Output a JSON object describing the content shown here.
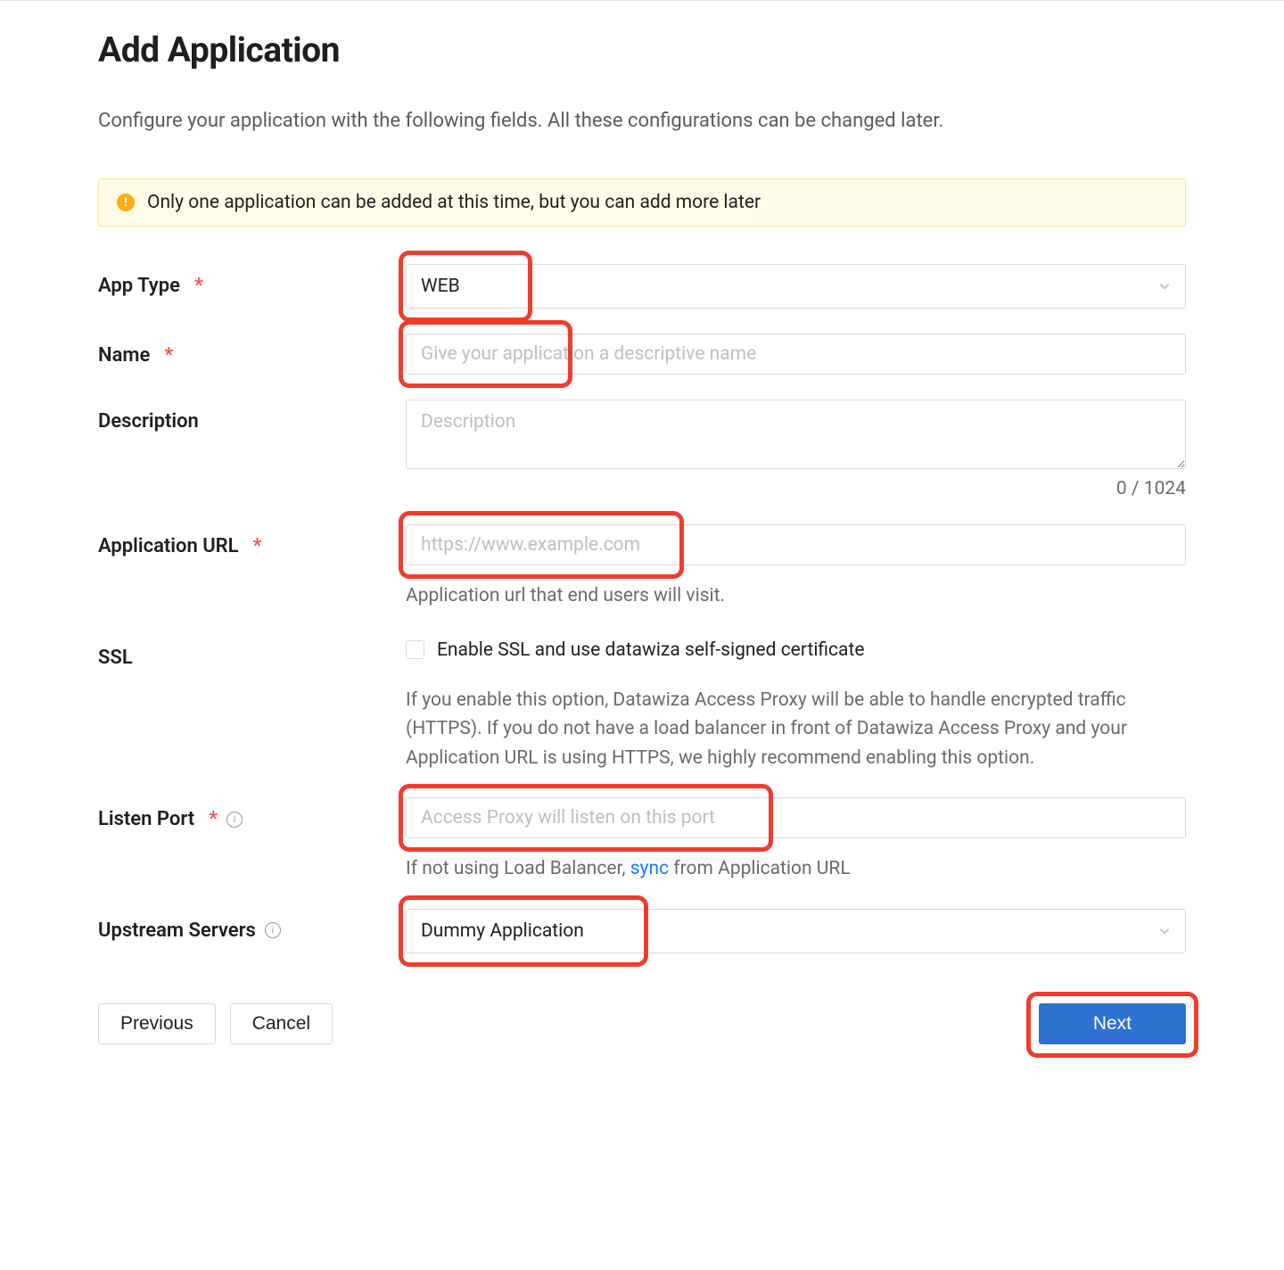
{
  "page": {
    "title": "Add Application",
    "intro": "Configure your application with the following fields. All these configurations can be changed later."
  },
  "alert": {
    "text": "Only one application can be added at this time, but you can add more later"
  },
  "fields": {
    "app_type": {
      "label": "App Type",
      "value": "WEB"
    },
    "name": {
      "label": "Name",
      "placeholder": "Give your application a descriptive name"
    },
    "description": {
      "label": "Description",
      "placeholder": "Description",
      "counter": "0 / 1024"
    },
    "application_url": {
      "label": "Application URL",
      "placeholder": "https://www.example.com",
      "help": "Application url that end users will visit."
    },
    "ssl": {
      "label": "SSL",
      "checkbox_label": "Enable SSL and use datawiza self-signed certificate",
      "help": "If you enable this option, Datawiza Access Proxy will be able to handle encrypted traffic (HTTPS). If you do not have a load balancer in front of Datawiza Access Proxy and your Application URL is using HTTPS, we highly recommend enabling this option."
    },
    "listen_port": {
      "label": "Listen Port",
      "placeholder": "Access Proxy will listen on this port",
      "help_prefix": "If not using Load Balancer, ",
      "help_link": "sync",
      "help_suffix": " from Application URL"
    },
    "upstream": {
      "label": "Upstream Servers",
      "value": "Dummy Application"
    }
  },
  "buttons": {
    "previous": "Previous",
    "cancel": "Cancel",
    "next": "Next"
  }
}
